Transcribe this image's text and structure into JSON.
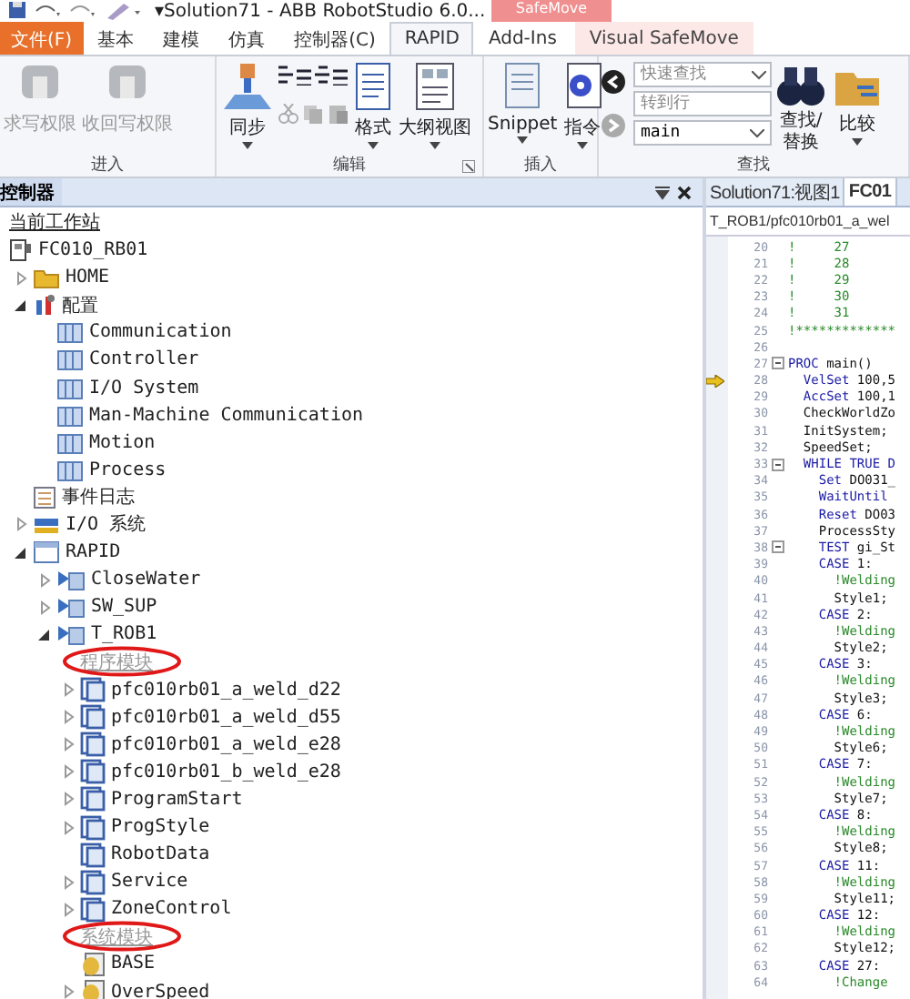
{
  "title_bar": {
    "title": "▾Solution71 - ABB RobotStudio 6.0...",
    "context_label": "SafeMove"
  },
  "menu_tabs": [
    {
      "label": "文件(F)",
      "kind": "file",
      "selected": false
    },
    {
      "label": "基本",
      "kind": "tab",
      "selected": false
    },
    {
      "label": "建模",
      "kind": "tab",
      "selected": false
    },
    {
      "label": "仿真",
      "kind": "tab",
      "selected": false
    },
    {
      "label": "控制器(C)",
      "kind": "tab",
      "selected": false
    },
    {
      "label": "RAPID",
      "kind": "tab",
      "selected": true
    },
    {
      "label": "Add-Ins",
      "kind": "tab",
      "selected": false
    },
    {
      "label": "Visual SafeMove",
      "kind": "context",
      "selected": false
    }
  ],
  "ribbon": {
    "enter": {
      "label": "进入",
      "buttons": [
        {
          "label": "求写权限",
          "disabled": true
        },
        {
          "label": "收回写权限",
          "disabled": true
        }
      ]
    },
    "edit": {
      "label": "编辑",
      "sync": "同步",
      "format": "格式",
      "outline": "大纲视图"
    },
    "insert": {
      "label": "插入",
      "snippet": "Snippet",
      "instruction": "指令"
    },
    "find": {
      "label": "查找",
      "quick_search": {
        "placeholder": "快速查找"
      },
      "goto_line": {
        "placeholder": "转到行"
      },
      "routine": {
        "value": "main"
      },
      "find_replace": [
        "查找/",
        "替换"
      ],
      "compare": "比较"
    }
  },
  "controller_panel": {
    "tab": "控制器",
    "heading": "当前工作站",
    "tree": [
      {
        "label": "FC010_RB01",
        "kind": "controller",
        "children": [
          {
            "label": "HOME",
            "kind": "folder",
            "expanded": false
          },
          {
            "label": "配置",
            "kind": "config",
            "expanded": true,
            "children": [
              {
                "label": "Communication",
                "kind": "table"
              },
              {
                "label": "Controller",
                "kind": "table"
              },
              {
                "label": "I/O System",
                "kind": "table"
              },
              {
                "label": "Man-Machine Communication",
                "kind": "table"
              },
              {
                "label": "Motion",
                "kind": "table"
              },
              {
                "label": "Process",
                "kind": "table"
              }
            ]
          },
          {
            "label": "事件日志",
            "kind": "log"
          },
          {
            "label": "I/O 系统",
            "kind": "io",
            "expanded": false
          },
          {
            "label": "RAPID",
            "kind": "rapid",
            "expanded": true,
            "children": [
              {
                "label": "CloseWater",
                "kind": "task",
                "expanded": false
              },
              {
                "label": "SW_SUP",
                "kind": "task",
                "expanded": false
              },
              {
                "label": "T_ROB1",
                "kind": "task",
                "expanded": true,
                "children": [
                  {
                    "label": "程序模块",
                    "kind": "group",
                    "circled": true
                  },
                  {
                    "label": "pfc010rb01_a_weld_d22",
                    "kind": "module",
                    "expanded": false
                  },
                  {
                    "label": "pfc010rb01_a_weld_d55",
                    "kind": "module",
                    "expanded": false
                  },
                  {
                    "label": "pfc010rb01_a_weld_e28",
                    "kind": "module",
                    "expanded": false
                  },
                  {
                    "label": "pfc010rb01_b_weld_e28",
                    "kind": "module",
                    "expanded": false
                  },
                  {
                    "label": "ProgramStart",
                    "kind": "module",
                    "expanded": false
                  },
                  {
                    "label": "ProgStyle",
                    "kind": "module",
                    "expanded": false
                  },
                  {
                    "label": "RobotData",
                    "kind": "module"
                  },
                  {
                    "label": "Service",
                    "kind": "module",
                    "expanded": false
                  },
                  {
                    "label": "ZoneControl",
                    "kind": "module",
                    "expanded": false
                  },
                  {
                    "label": "系统模块",
                    "kind": "group",
                    "circled": true
                  },
                  {
                    "label": "BASE",
                    "kind": "sysmod"
                  },
                  {
                    "label": "OverSpeed",
                    "kind": "sysmod",
                    "expanded": false
                  }
                ]
              }
            ]
          }
        ]
      }
    ]
  },
  "editor": {
    "tabs": [
      {
        "label": "Solution71:视图1",
        "selected": false
      },
      {
        "label": "FC01",
        "selected": true
      }
    ],
    "path": "T_ROB1/pfc010rb01_a_wel",
    "lines": [
      {
        "n": "20",
        "tokens": [
          {
            "kind": "comment",
            "text": "!     27"
          }
        ]
      },
      {
        "n": "21",
        "tokens": [
          {
            "kind": "comment",
            "text": "!     28"
          }
        ]
      },
      {
        "n": "22",
        "tokens": [
          {
            "kind": "comment",
            "text": "!     29"
          }
        ]
      },
      {
        "n": "23",
        "tokens": [
          {
            "kind": "comment",
            "text": "!     30"
          }
        ]
      },
      {
        "n": "24",
        "tokens": [
          {
            "kind": "comment",
            "text": "!     31"
          }
        ]
      },
      {
        "n": "25",
        "tokens": [
          {
            "kind": "comment",
            "text": "!*************"
          }
        ]
      },
      {
        "n": "26"
      },
      {
        "n": "27",
        "fold": true,
        "tokens": [
          {
            "kind": "keyword",
            "text": "PROC"
          },
          {
            "kind": "plain",
            "text": " main()"
          }
        ]
      },
      {
        "n": "28",
        "pointer": true,
        "tokens": [
          {
            "kind": "keyword",
            "text": "  VelSet"
          },
          {
            "kind": "plain",
            "text": " 100,5"
          }
        ]
      },
      {
        "n": "29",
        "tokens": [
          {
            "kind": "keyword",
            "text": "  AccSet"
          },
          {
            "kind": "plain",
            "text": " 100,1"
          }
        ]
      },
      {
        "n": "30",
        "tokens": [
          {
            "kind": "plain",
            "text": "  CheckWorldZo"
          }
        ]
      },
      {
        "n": "31",
        "tokens": [
          {
            "kind": "plain",
            "text": "  InitSystem;"
          }
        ]
      },
      {
        "n": "32",
        "tokens": [
          {
            "kind": "plain",
            "text": "  SpeedSet;"
          }
        ]
      },
      {
        "n": "33",
        "fold": true,
        "tokens": [
          {
            "kind": "keyword",
            "text": "  WHILE TRUE D"
          }
        ]
      },
      {
        "n": "34",
        "tokens": [
          {
            "kind": "keyword",
            "text": "    Set"
          },
          {
            "kind": "plain",
            "text": " DO031_"
          }
        ]
      },
      {
        "n": "35",
        "tokens": [
          {
            "kind": "keyword",
            "text": "    WaitUntil"
          }
        ]
      },
      {
        "n": "36",
        "tokens": [
          {
            "kind": "keyword",
            "text": "    Reset"
          },
          {
            "kind": "plain",
            "text": " DO03"
          }
        ]
      },
      {
        "n": "37",
        "tokens": [
          {
            "kind": "plain",
            "text": "    ProcessSty"
          }
        ]
      },
      {
        "n": "38",
        "fold": true,
        "tokens": [
          {
            "kind": "keyword",
            "text": "    TEST"
          },
          {
            "kind": "plain",
            "text": " gi_St"
          }
        ]
      },
      {
        "n": "39",
        "tokens": [
          {
            "kind": "keyword",
            "text": "    CASE"
          },
          {
            "kind": "plain",
            "text": " 1:"
          }
        ]
      },
      {
        "n": "40",
        "tokens": [
          {
            "kind": "comment",
            "text": "      !Welding"
          }
        ]
      },
      {
        "n": "41",
        "tokens": [
          {
            "kind": "plain",
            "text": "      Style1;"
          }
        ]
      },
      {
        "n": "42",
        "tokens": [
          {
            "kind": "keyword",
            "text": "    CASE"
          },
          {
            "kind": "plain",
            "text": " 2:"
          }
        ]
      },
      {
        "n": "43",
        "tokens": [
          {
            "kind": "comment",
            "text": "      !Welding"
          }
        ]
      },
      {
        "n": "44",
        "tokens": [
          {
            "kind": "plain",
            "text": "      Style2;"
          }
        ]
      },
      {
        "n": "45",
        "tokens": [
          {
            "kind": "keyword",
            "text": "    CASE"
          },
          {
            "kind": "plain",
            "text": " 3:"
          }
        ]
      },
      {
        "n": "46",
        "tokens": [
          {
            "kind": "comment",
            "text": "      !Welding"
          }
        ]
      },
      {
        "n": "47",
        "tokens": [
          {
            "kind": "plain",
            "text": "      Style3;"
          }
        ]
      },
      {
        "n": "48",
        "tokens": [
          {
            "kind": "keyword",
            "text": "    CASE"
          },
          {
            "kind": "plain",
            "text": " 6:"
          }
        ]
      },
      {
        "n": "49",
        "tokens": [
          {
            "kind": "comment",
            "text": "      !Welding"
          }
        ]
      },
      {
        "n": "50",
        "tokens": [
          {
            "kind": "plain",
            "text": "      Style6;"
          }
        ]
      },
      {
        "n": "51",
        "tokens": [
          {
            "kind": "keyword",
            "text": "    CASE"
          },
          {
            "kind": "plain",
            "text": " 7:"
          }
        ]
      },
      {
        "n": "52",
        "tokens": [
          {
            "kind": "comment",
            "text": "      !Welding"
          }
        ]
      },
      {
        "n": "53",
        "tokens": [
          {
            "kind": "plain",
            "text": "      Style7;"
          }
        ]
      },
      {
        "n": "54",
        "tokens": [
          {
            "kind": "keyword",
            "text": "    CASE"
          },
          {
            "kind": "plain",
            "text": " 8:"
          }
        ]
      },
      {
        "n": "55",
        "tokens": [
          {
            "kind": "comment",
            "text": "      !Welding"
          }
        ]
      },
      {
        "n": "56",
        "tokens": [
          {
            "kind": "plain",
            "text": "      Style8;"
          }
        ]
      },
      {
        "n": "57",
        "tokens": [
          {
            "kind": "keyword",
            "text": "    CASE"
          },
          {
            "kind": "plain",
            "text": " 11:"
          }
        ]
      },
      {
        "n": "58",
        "tokens": [
          {
            "kind": "comment",
            "text": "      !Welding"
          }
        ]
      },
      {
        "n": "59",
        "tokens": [
          {
            "kind": "plain",
            "text": "      Style11;"
          }
        ]
      },
      {
        "n": "60",
        "tokens": [
          {
            "kind": "keyword",
            "text": "    CASE"
          },
          {
            "kind": "plain",
            "text": " 12:"
          }
        ]
      },
      {
        "n": "61",
        "tokens": [
          {
            "kind": "comment",
            "text": "      !Welding"
          }
        ]
      },
      {
        "n": "62",
        "tokens": [
          {
            "kind": "plain",
            "text": "      Style12;"
          }
        ]
      },
      {
        "n": "63",
        "tokens": [
          {
            "kind": "keyword",
            "text": "    CASE"
          },
          {
            "kind": "plain",
            "text": " 27:"
          }
        ]
      },
      {
        "n": "64",
        "tokens": [
          {
            "kind": "comment",
            "text": "      !Change"
          }
        ]
      }
    ]
  }
}
